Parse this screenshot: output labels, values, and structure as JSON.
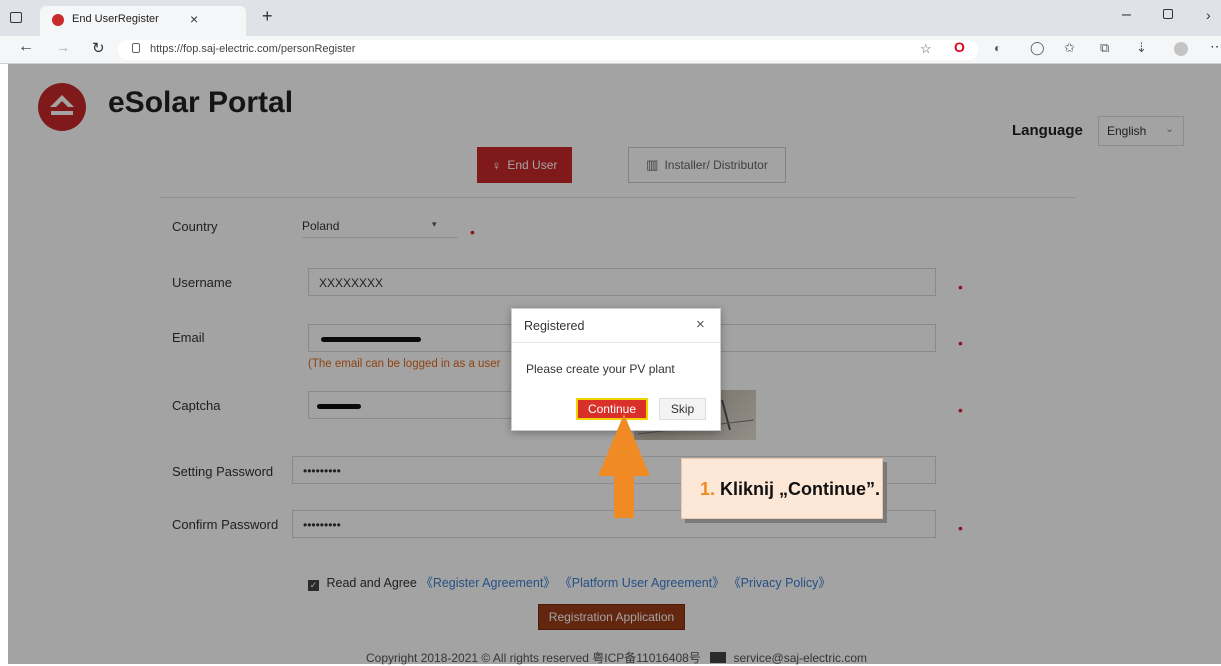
{
  "browser": {
    "tab_title": "End UserRegister",
    "url": "https://fop.saj-electric.com/personRegister"
  },
  "header": {
    "title": "eSolar Portal",
    "language_label": "Language",
    "language_value": "English"
  },
  "tabs": {
    "end_user": "End User",
    "installer": "Installer/ Distributor"
  },
  "form": {
    "country_label": "Country",
    "country_value": "Poland",
    "username_label": "Username",
    "username_value": "XXXXXXXX",
    "email_label": "Email",
    "email_note": "(The email can be logged in as a user",
    "captcha_label": "Captcha",
    "password_label": "Setting Password",
    "password_value": "•••••••••",
    "confirm_label": "Confirm Password",
    "confirm_value": "•••••••••",
    "agree_text": "Read and Agree",
    "register_agreement": "《Register Agreement》",
    "platform_agreement": "《Platform User Agreement》",
    "privacy_policy": "《Privacy Policy》",
    "submit_label": "Registration Application"
  },
  "footer": {
    "copyright": "Copyright 2018-2021 © All rights reserved 粤ICP备11016408号",
    "email": "service@saj-electric.com"
  },
  "dialog": {
    "title": "Registered",
    "message": "Please create your PV plant",
    "continue_label": "Continue",
    "skip_label": "Skip"
  },
  "callout": {
    "number": "1.",
    "text": "Kliknij „Continue”."
  },
  "colors": {
    "brand_red": "#c92a2a",
    "accent_orange": "#f08a24",
    "submit_brown": "#9c3c18"
  },
  "icons": [
    "tab-actions-icon",
    "site-favicon",
    "close-tab-icon",
    "new-tab-icon",
    "back-icon",
    "forward-icon",
    "refresh-icon",
    "lock-icon",
    "logo-icon",
    "user-icon",
    "building-icon",
    "mail-icon",
    "dropdown-icon",
    "checkbox-icon"
  ]
}
